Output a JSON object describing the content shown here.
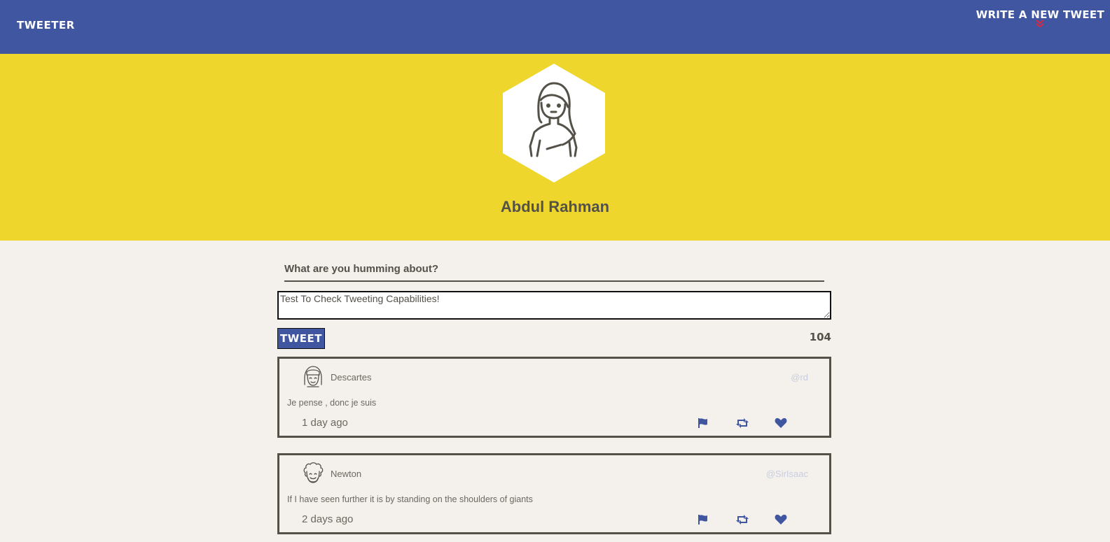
{
  "nav": {
    "brand": "Tweeter",
    "write_label": "Write a new tweet",
    "write_chevron": "»"
  },
  "profile": {
    "name": "Abdul Rahman",
    "avatar_icon": "woman-avatar-icon"
  },
  "composer": {
    "prompt": "What are you humming about?",
    "text_value": "Test To Check Tweeting Capabilities!",
    "button_label": "Tweet",
    "counter": "104"
  },
  "tweets": [
    {
      "name": "Descartes",
      "handle": "@rd",
      "content": "Je pense , donc je suis",
      "time": "1 day ago",
      "avatar_icon": "bangs-avatar-icon"
    },
    {
      "name": "Newton",
      "handle": "@SirIsaac",
      "content": "If I have seen further it is by standing on the shoulders of giants",
      "time": "2 days ago",
      "avatar_icon": "curly-avatar-icon"
    }
  ],
  "actions": {
    "flag_icon": "flag-icon",
    "retweet_icon": "retweet-icon",
    "like_icon": "heart-icon"
  },
  "colors": {
    "nav_bg": "#4056a1",
    "header_bg": "#efd62d",
    "page_bg": "#f4f1ec",
    "text": "#545149",
    "accent_red": "#e0263a",
    "handle": "#c9cde0"
  }
}
